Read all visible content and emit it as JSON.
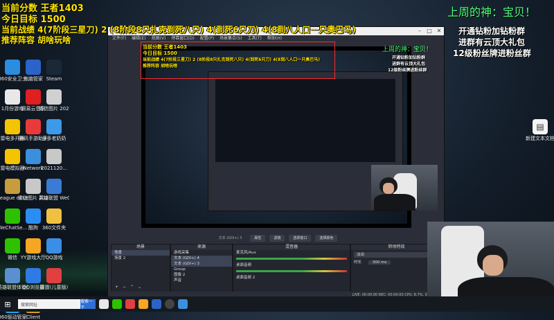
{
  "overlay": {
    "score_line": "当前分数 王者1403",
    "target_line": "今日目标 1500",
    "record_line": "当前战绩 4(7阶段三星刀) 2 (8阶段8只扎克到死八只) 4(到死6只刀) 4(8到八人口一只奥巴马)",
    "recommend_line": "推荐阵容 胡啥玩啥",
    "god_line": "上周的神：宝贝！",
    "fan_lines": [
      "开通钻粉加钻粉群",
      "进群有云顶大礼包",
      "12级粉丝牌进粉丝群"
    ]
  },
  "desktop_icons": [
    {
      "label": "360安全卫士",
      "name": "360-safe-icon",
      "color": "#2a8de0"
    },
    {
      "label": "电脑管家",
      "name": "pc-manager-icon",
      "color": "#2a64c8"
    },
    {
      "label": "Steam",
      "name": "steam-icon",
      "color": "#1b2838"
    },
    {
      "label": "1月份游戏",
      "name": "file-icon",
      "color": "#e8e8e8"
    },
    {
      "label": "网易云音乐",
      "name": "netease-music-icon",
      "color": "#e02020"
    },
    {
      "label": "微信图片 2022021...",
      "name": "image-file-icon",
      "color": "#d0d0d0"
    },
    {
      "label": "雷电多开器",
      "name": "leidian-multi-icon",
      "color": "#f5c400"
    },
    {
      "label": "腾讯手游助手",
      "name": "tencent-game-icon",
      "color": "#e83a3a"
    },
    {
      "label": "多多老奶奶",
      "name": "app-icon",
      "color": "#3c9ae8"
    },
    {
      "label": "雷电模拟器",
      "name": "leidian-emulator-icon",
      "color": "#f5c400"
    },
    {
      "label": "Network",
      "name": "network-icon",
      "color": "#3b8fdc"
    },
    {
      "label": "2021120...",
      "name": "image-file-icon",
      "color": "#c8c8c8"
    },
    {
      "label": "League of Legends",
      "name": "lol-icon",
      "color": "#c89b3c"
    },
    {
      "label": "微信图片 2022021...",
      "name": "image-file-icon",
      "color": "#c8c8c8"
    },
    {
      "label": "英雄联盟 WeGame版",
      "name": "wegame-lol-icon",
      "color": "#3a7bd5"
    },
    {
      "label": "WeChatSe...",
      "name": "wechat-icon",
      "color": "#2dc100"
    },
    {
      "label": "酷狗",
      "name": "kugou-icon",
      "color": "#2a8df0"
    },
    {
      "label": "360文件夹",
      "name": "folder-icon",
      "color": "#f0c040"
    },
    {
      "label": "微信",
      "name": "wechat-icon",
      "color": "#2dc100"
    },
    {
      "label": "YY游戏大厅",
      "name": "yy-icon",
      "color": "#f5a623"
    },
    {
      "label": "QQ游戏",
      "name": "qq-game-icon",
      "color": "#3a8ee6"
    },
    {
      "label": "英雄联盟体验服",
      "name": "lol-pbe-icon",
      "color": "#5a8fd0"
    },
    {
      "label": "QQ浏览器",
      "name": "qq-browser-icon",
      "color": "#2f7ae5"
    },
    {
      "label": "雷霆(儿童版)",
      "name": "app-icon",
      "color": "#e04040"
    },
    {
      "label": "360驱动管家",
      "name": "360-driver-icon",
      "color": "#2aa0e0"
    },
    {
      "label": "Client",
      "name": "client-icon",
      "color": "#d4a020"
    }
  ],
  "right_icon": {
    "label": "新建文本文档",
    "name": "text-file-icon"
  },
  "obs": {
    "menu": [
      "文件(F)",
      "编辑(E)",
      "视图(V)",
      "停靠窗口(D)",
      "配置(P)",
      "场景集合(S)",
      "工具(T)",
      "帮助(H)"
    ],
    "source_bar": [
      "文本 (GDI+) 3"
    ],
    "toolbar_buttons": [
      "属性",
      "滤镜",
      "选择窗口",
      "选择颜色"
    ],
    "scenes_title": "场景",
    "scenes": [
      "场景",
      "场景 2"
    ],
    "sources_title": "来源",
    "sources": [
      "游戏采集",
      "文本 (GDI+) 4",
      "文本 (GDI+) 3",
      "Group",
      "图像 2",
      "声音"
    ],
    "mixer_title": "混音器",
    "mixer": [
      "麦克风/Aux",
      "桌面音频",
      "桌面音频 2"
    ],
    "transitions_title": "转场特效",
    "transition_value": "淡出",
    "duration_label": "时长",
    "duration_value": "300 ms",
    "status": "LIVE: 00:00:00  REC: 00:00:00  CPU: 8.7%, 30.00 fps"
  },
  "taskbar": {
    "search_placeholder": "搜索网址",
    "search_button": "搜索一下"
  }
}
